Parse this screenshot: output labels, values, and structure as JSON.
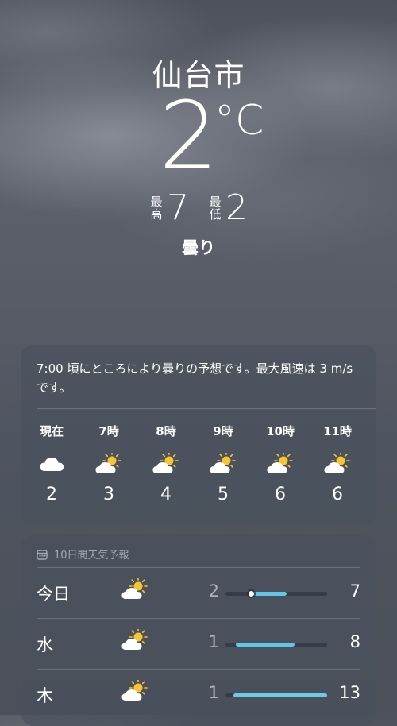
{
  "location": {
    "city": "仙台市",
    "temp": "2",
    "unit": "°C",
    "condition": "曇り"
  },
  "highlow": {
    "high_label_1": "最",
    "high_label_2": "高",
    "high": "7",
    "low_label_1": "最",
    "low_label_2": "低",
    "low": "2"
  },
  "hourly": {
    "summary": "7:00 頃にところにより曇りの予想です。最大風速は 3 m/s です。",
    "hours": [
      {
        "time": "現在",
        "icon": "cloud-icon",
        "temp": "2"
      },
      {
        "time": "7時",
        "icon": "partly-sunny-icon",
        "temp": "3"
      },
      {
        "time": "8時",
        "icon": "partly-sunny-icon",
        "temp": "4"
      },
      {
        "time": "9時",
        "icon": "partly-sunny-icon",
        "temp": "5"
      },
      {
        "time": "10時",
        "icon": "partly-sunny-icon",
        "temp": "6"
      },
      {
        "time": "11時",
        "icon": "partly-sunny-icon",
        "temp": "6"
      }
    ]
  },
  "forecast": {
    "title": "10日間天気予報",
    "icon": "calendar-icon",
    "days": [
      {
        "day": "今日",
        "icon": "partly-sunny-icon",
        "low": "2",
        "high": "7",
        "range_start": 0.25,
        "range_end": 0.6,
        "current_marker": 0.25,
        "bar_color": "#62c6e6"
      },
      {
        "day": "水",
        "icon": "partly-sunny-icon",
        "low": "1",
        "high": "8",
        "range_start": 0.1,
        "range_end": 0.68,
        "bar_color": "#62c6e6"
      },
      {
        "day": "木",
        "icon": "partly-sunny-icon",
        "low": "1",
        "high": "13",
        "range_start": 0.08,
        "range_end": 1.0,
        "bar_color": "#6ccbe4"
      }
    ]
  },
  "colors": {
    "accent_bar": "#62c6e6",
    "sun": "#f6c531",
    "card": "#48505c"
  }
}
